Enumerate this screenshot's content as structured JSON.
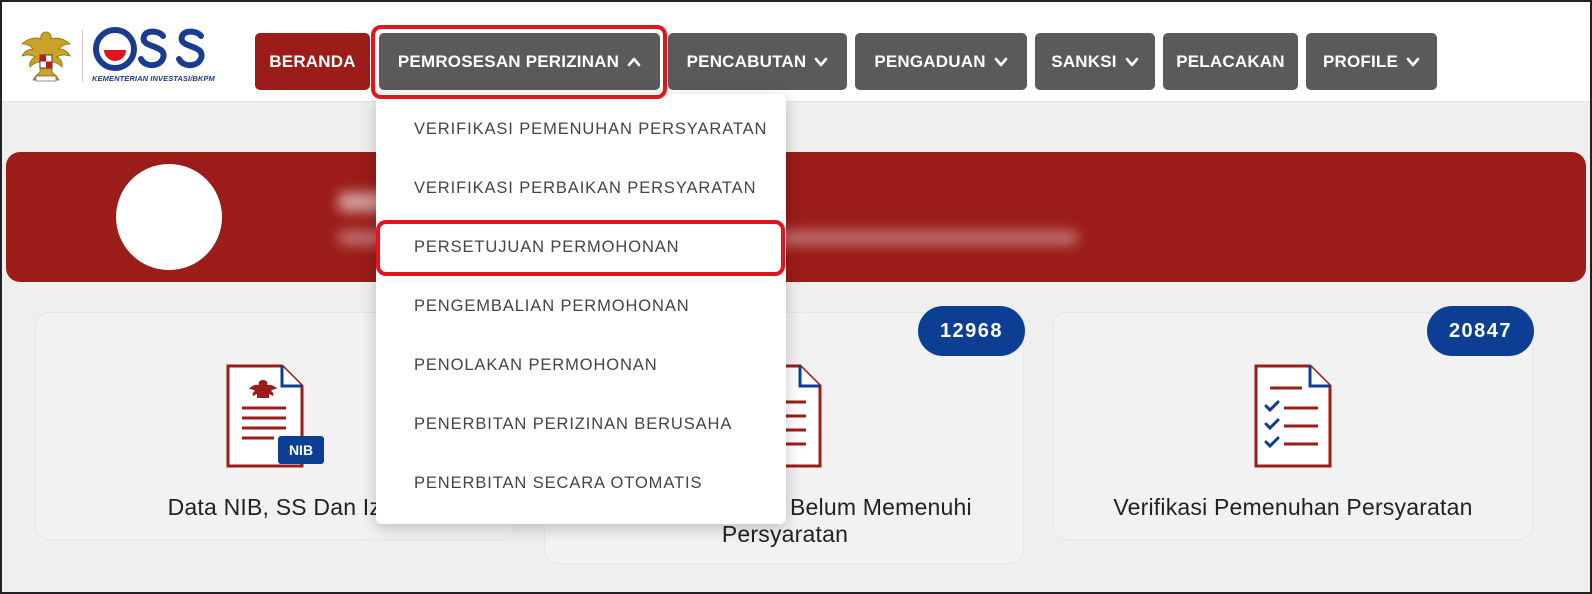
{
  "header": {
    "logo_text": "KEMENTERIAN INVESTASI/BKPM"
  },
  "nav": {
    "items": [
      {
        "label": "BERANDA"
      },
      {
        "label": "PEMROSESAN PERIZINAN"
      },
      {
        "label": "PENCABUTAN"
      },
      {
        "label": "PENGADUAN"
      },
      {
        "label": "SANKSI"
      },
      {
        "label": "PELACAKAN"
      },
      {
        "label": "PROFILE"
      }
    ]
  },
  "dropdown": {
    "items": [
      {
        "label": "VERIFIKASI PEMENUHAN PERSYARATAN"
      },
      {
        "label": "VERIFIKASI PERBAIKAN PERSYARATAN"
      },
      {
        "label": "PERSETUJUAN PERMOHONAN"
      },
      {
        "label": "PENGEMBALIAN PERMOHONAN"
      },
      {
        "label": "PENOLAKAN PERMOHONAN"
      },
      {
        "label": "PENERBITAN PERIZINAN BERUSAHA"
      },
      {
        "label": "PENERBITAN SECARA OTOMATIS"
      }
    ]
  },
  "cards": [
    {
      "title": "Data NIB, SS Dan Izi",
      "icon_badge": "NIB"
    },
    {
      "title_line1": "Belum Memenuhi",
      "title_line2": "Persyaratan",
      "count": "12968"
    },
    {
      "title": "Verifikasi Pemenuhan Persyaratan",
      "count": "20847"
    }
  ],
  "colors": {
    "brand_red": "#9b1c18",
    "nav_gray": "#5a5a5a",
    "badge_blue": "#0c3f93",
    "highlight_red": "#e3141c"
  }
}
